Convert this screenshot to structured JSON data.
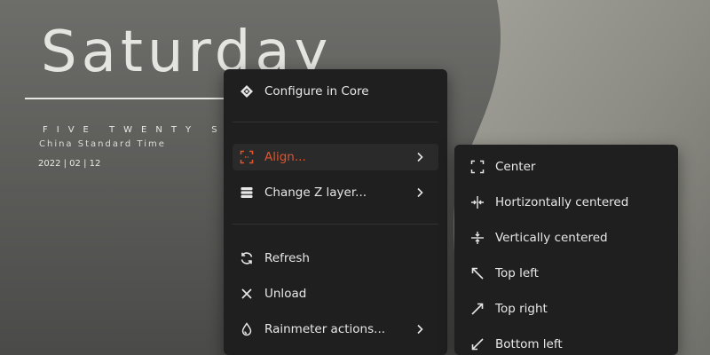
{
  "desktop": {
    "clock": {
      "day": "Saturday",
      "time_words": "FIVE TWENTY S",
      "timezone": "China Standard Time",
      "date": "2022 | 02 | 12"
    }
  },
  "context_menu": {
    "items": [
      {
        "label": "Configure in Core",
        "icon": "core-icon"
      },
      {
        "label": "Align...",
        "icon": "align-icon",
        "submenu": true,
        "active": true
      },
      {
        "label": "Change Z layer...",
        "icon": "layers-icon",
        "submenu": true
      },
      {
        "label": "Refresh",
        "icon": "refresh-icon"
      },
      {
        "label": "Unload",
        "icon": "close-icon"
      },
      {
        "label": "Rainmeter actions...",
        "icon": "drop-icon",
        "submenu": true
      }
    ]
  },
  "align_submenu": {
    "items": [
      {
        "label": "Center",
        "icon": "center-frame-icon"
      },
      {
        "label": "Hortizontally centered",
        "icon": "horizontal-center-icon"
      },
      {
        "label": "Vertically centered",
        "icon": "vertical-center-icon"
      },
      {
        "label": "Top left",
        "icon": "arrow-top-left-icon"
      },
      {
        "label": "Top right",
        "icon": "arrow-top-right-icon"
      },
      {
        "label": "Bottom left",
        "icon": "arrow-bottom-left-icon"
      }
    ]
  },
  "colors": {
    "accent": "#e0542c",
    "menu_bg": "#1f1f1f",
    "text": "#e8e8e8"
  }
}
